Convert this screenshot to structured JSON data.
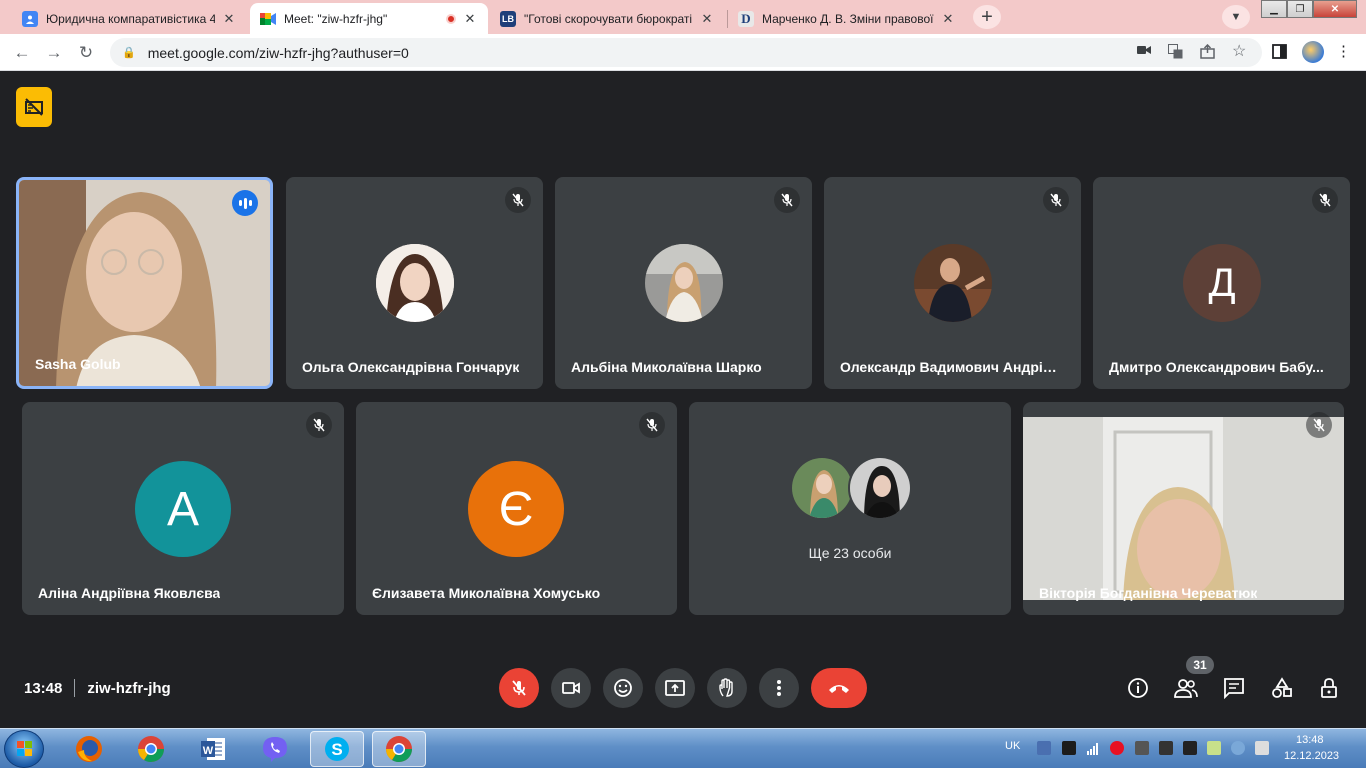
{
  "browser": {
    "tabs": [
      {
        "title": "Юридична компаративістика 4",
        "active": false
      },
      {
        "title": "Meet: \"ziw-hzfr-jhg\"",
        "active": true,
        "recording": true
      },
      {
        "title": "\"Готові скорочувати бюрократі",
        "active": false,
        "favicon_text": "LB"
      },
      {
        "title": "Марченко Д. В. Зміни правової",
        "active": false,
        "favicon_text": "D"
      }
    ],
    "new_tab_label": "+",
    "url": "meet.google.com/ziw-hzfr-jhg?authuser=0"
  },
  "meeting": {
    "time": "13:48",
    "code": "ziw-hzfr-jhg",
    "participant_count": "31",
    "others_label": "Ще 23 особи",
    "participants": [
      {
        "name": "Sasha Golub",
        "type": "video",
        "speaking": true
      },
      {
        "name": "Ольга Олександрівна Гончарук",
        "type": "photo",
        "muted": true
      },
      {
        "name": "Альбіна Миколаївна Шарко",
        "type": "photo",
        "muted": true
      },
      {
        "name": "Олександр Вадимович Андріяш",
        "type": "photo",
        "muted": true
      },
      {
        "name": "Дмитро Олександрович Бабу...",
        "type": "letter",
        "letter": "Д",
        "color": "#5d4037",
        "muted": true
      },
      {
        "name": "Аліна Андріївна Яковлєва",
        "type": "letter",
        "letter": "А",
        "color": "#12939a",
        "muted": true
      },
      {
        "name": "Єлизавета Миколаївна Хомусько",
        "type": "letter",
        "letter": "Є",
        "color": "#e8710a",
        "muted": true
      },
      {
        "name": "Вікторія Богданівна Череватюк",
        "type": "video",
        "muted": true
      }
    ]
  },
  "taskbar": {
    "language": "UK",
    "clock_time": "13:48",
    "clock_date": "12.12.2023"
  },
  "colors": {
    "meet_bg": "#202124",
    "tile_bg": "#3c4043",
    "hangup_red": "#ea4335",
    "speaking_border": "#8ab4f8",
    "tab_strip": "#f3c9c9"
  }
}
